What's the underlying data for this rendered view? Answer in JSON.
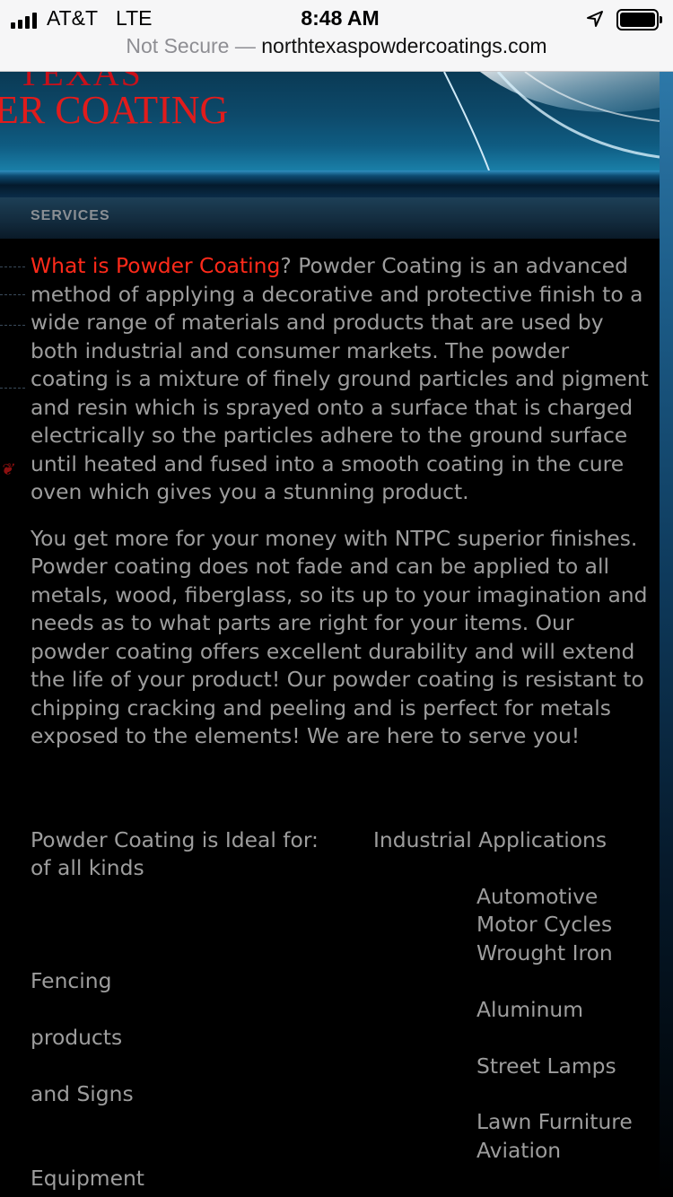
{
  "status_bar": {
    "carrier": "AT&T",
    "network": "LTE",
    "time": "8:48 AM",
    "icons": [
      "signal-icon",
      "location-icon",
      "battery-icon"
    ]
  },
  "url_bar": {
    "security": "Not Secure",
    "separator": "—",
    "domain": "northtexaspowdercoatings.com"
  },
  "header": {
    "brand_partial": "ER COATING",
    "brand_top_partial": "TEXAS",
    "colors": {
      "brand": "#e01c1c",
      "banner": "#0d4a6b"
    }
  },
  "nav": {
    "label": "SERVICES"
  },
  "content": {
    "intro_link": "What is Powder Coating",
    "intro_text": "?  Powder Coating is an advanced method of applying a decorative and protective finish to a wide range of materials and products that are used by both industrial and consumer markets.  The powder coating is a mixture of finely ground particles and pigment and resin which is sprayed onto a surface that is charged electrically so the particles adhere to the ground surface until heated and fused into a smooth coating in the cure oven which gives you a stunning product.",
    "paragraph2": "You get more for your money with NTPC superior finishes.  Powder coating does not fade and can be applied to all metals, wood, fiberglass, so its up to your imagination and needs as to what parts are right for your items.  Our powder coating offers excellent durability and will extend the life of your product! Our powder coating is resistant to chipping cracking and peeling and is perfect for metals exposed to the elements!  We are here to serve you!",
    "ideal_label": "Powder Coating is Ideal for:",
    "ideal_first": "Industrial Applications",
    "ideal_first_tail": "of all kinds",
    "applications": {
      "automotive": "Automotive",
      "motor_cycles": "Motor Cycles",
      "wrought_iron": "Wrought Iron",
      "fencing": "Fencing",
      "aluminum": "Aluminum",
      "products": "products",
      "street_lamps": "Street Lamps",
      "and_signs": "and Signs",
      "lawn_furniture": "Lawn Furniture",
      "aviation": "Aviation",
      "equipment": "Equipment"
    }
  }
}
